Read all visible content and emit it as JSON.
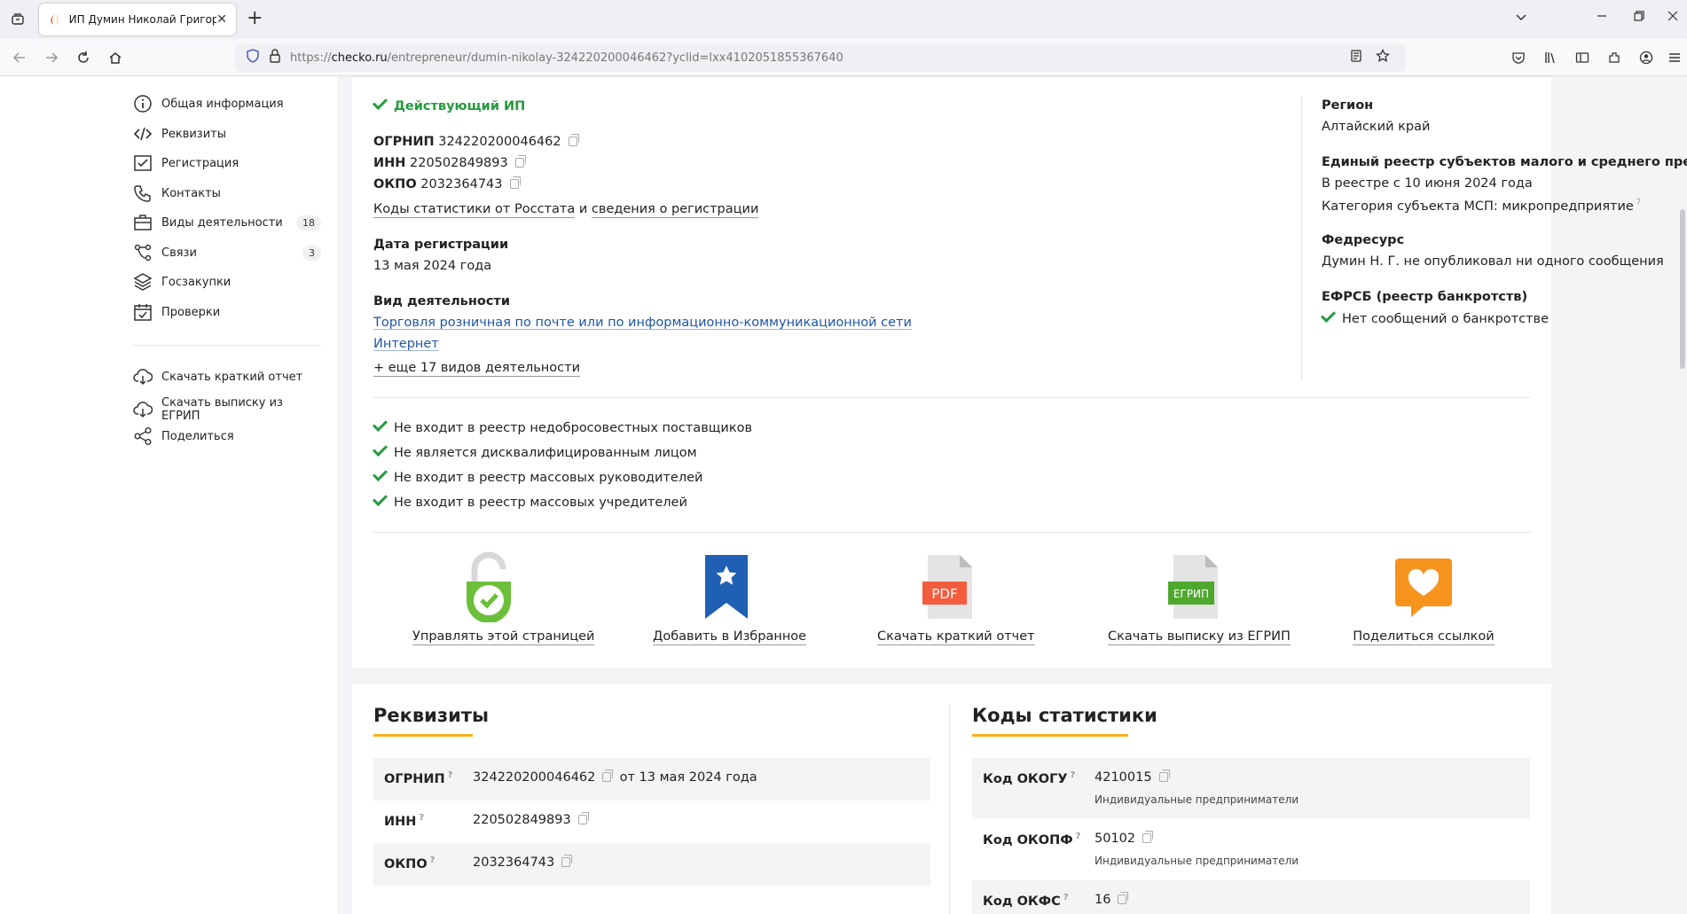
{
  "browser": {
    "tab_title": "ИП Думин Николай Григорье",
    "url_prefix": "https://",
    "url_host": "checko.ru",
    "url_path": "/entrepreneur/dumin-nikolay-324220200046462?yclid=lxx4102051855367640"
  },
  "sidebar": {
    "items": [
      {
        "label": "Общая информация",
        "icon": "info-icon"
      },
      {
        "label": "Реквизиты",
        "icon": "code-icon"
      },
      {
        "label": "Регистрация",
        "icon": "registration-icon"
      },
      {
        "label": "Контакты",
        "icon": "phone-icon"
      },
      {
        "label": "Виды деятельности",
        "icon": "briefcase-icon",
        "badge": "18"
      },
      {
        "label": "Связи",
        "icon": "connections-icon",
        "badge": "3"
      },
      {
        "label": "Госзакупки",
        "icon": "layers-icon"
      },
      {
        "label": "Проверки",
        "icon": "calendar-check-icon"
      }
    ],
    "actions": [
      {
        "label": "Скачать краткий отчет",
        "icon": "cloud-download-icon"
      },
      {
        "label": "Скачать выписку из ЕГРИП",
        "icon": "cloud-download-icon"
      },
      {
        "label": "Поделиться",
        "icon": "share-icon"
      }
    ]
  },
  "summary": {
    "status": "Действующий ИП",
    "ogrnip_label": "ОГРНИП",
    "ogrnip": "324220200046462",
    "inn_label": "ИНН",
    "inn": "220502849893",
    "okpo_label": "ОКПО",
    "okpo": "2032364743",
    "stats_link_a": "Коды статистики от Росстата",
    "stats_link_and": "и",
    "stats_link_b": "сведения о регистрации",
    "reg_date_label": "Дата регистрации",
    "reg_date": "13 мая 2024 года",
    "activity_label": "Вид деятельности",
    "activity_line1": "Торговля розничная по почте или по информационно-коммуникационной сети",
    "activity_line2": "Интернет",
    "more_activities": "+ еще 17 видов деятельности",
    "region_label": "Регион",
    "region": "Алтайский край",
    "msp_label": "Единый реестр субъектов малого и среднего предпринимательства",
    "msp_since": "В реестре с 10 июня 2024 года",
    "msp_category": "Категория субъекта МСП: микропредприятие",
    "fedresurs_label": "Федресурс",
    "fedresurs_text": "Думин Н. Г. не опубликовал ни одного сообщения",
    "efrsb_label": "ЕФРСБ (реестр банкротств)",
    "efrsb_text": "Нет сообщений о банкротстве"
  },
  "checks": [
    "Не входит в реестр недобросовестных поставщиков",
    "Не является дисквалифицированным лицом",
    "Не входит в реестр массовых руководителей",
    "Не входит в реестр массовых учредителей"
  ],
  "actions": {
    "manage": "Управлять этой страницей",
    "favorite": "Добавить в Избранное",
    "pdf": "Скачать краткий отчет",
    "egrip": "Скачать выписку из ЕГРИП",
    "share": "Поделиться ссылкой",
    "pdf_badge": "PDF",
    "egrip_badge": "ЕГРИП"
  },
  "rekvizity": {
    "title": "Реквизиты",
    "rows": [
      {
        "k": "ОГРНИП",
        "v": "324220200046462",
        "extra": "от 13 мая 2024 года"
      },
      {
        "k": "ИНН",
        "v": "220502849893"
      },
      {
        "k": "ОКПО",
        "v": "2032364743"
      }
    ]
  },
  "stat_codes": {
    "title": "Коды статистики",
    "rows": [
      {
        "k": "Код ОКОГУ",
        "v": "4210015",
        "sub": "Индивидуальные предприниматели"
      },
      {
        "k": "Код ОКОПФ",
        "v": "50102",
        "sub": "Индивидуальные предприниматели"
      },
      {
        "k": "Код ОКФС",
        "v": "16"
      }
    ]
  },
  "colors": {
    "accent_green": "#259b3e",
    "link_blue": "#1f55a7",
    "underline_yellow": "#f5b11b"
  }
}
